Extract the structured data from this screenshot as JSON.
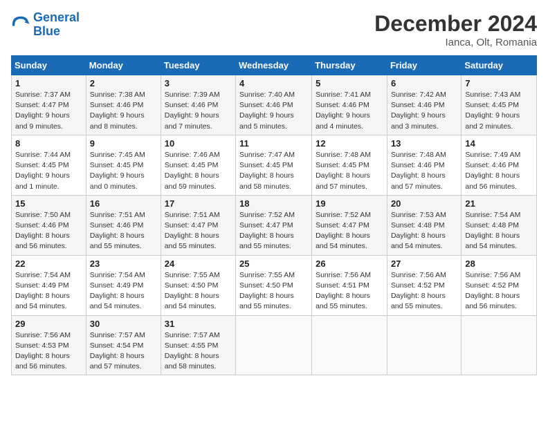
{
  "header": {
    "logo_line1": "General",
    "logo_line2": "Blue",
    "month": "December 2024",
    "location": "Ianca, Olt, Romania"
  },
  "weekdays": [
    "Sunday",
    "Monday",
    "Tuesday",
    "Wednesday",
    "Thursday",
    "Friday",
    "Saturday"
  ],
  "weeks": [
    [
      {
        "day": "1",
        "sunrise": "Sunrise: 7:37 AM",
        "sunset": "Sunset: 4:47 PM",
        "daylight": "Daylight: 9 hours and 9 minutes."
      },
      {
        "day": "2",
        "sunrise": "Sunrise: 7:38 AM",
        "sunset": "Sunset: 4:46 PM",
        "daylight": "Daylight: 9 hours and 8 minutes."
      },
      {
        "day": "3",
        "sunrise": "Sunrise: 7:39 AM",
        "sunset": "Sunset: 4:46 PM",
        "daylight": "Daylight: 9 hours and 7 minutes."
      },
      {
        "day": "4",
        "sunrise": "Sunrise: 7:40 AM",
        "sunset": "Sunset: 4:46 PM",
        "daylight": "Daylight: 9 hours and 5 minutes."
      },
      {
        "day": "5",
        "sunrise": "Sunrise: 7:41 AM",
        "sunset": "Sunset: 4:46 PM",
        "daylight": "Daylight: 9 hours and 4 minutes."
      },
      {
        "day": "6",
        "sunrise": "Sunrise: 7:42 AM",
        "sunset": "Sunset: 4:46 PM",
        "daylight": "Daylight: 9 hours and 3 minutes."
      },
      {
        "day": "7",
        "sunrise": "Sunrise: 7:43 AM",
        "sunset": "Sunset: 4:45 PM",
        "daylight": "Daylight: 9 hours and 2 minutes."
      }
    ],
    [
      {
        "day": "8",
        "sunrise": "Sunrise: 7:44 AM",
        "sunset": "Sunset: 4:45 PM",
        "daylight": "Daylight: 9 hours and 1 minute."
      },
      {
        "day": "9",
        "sunrise": "Sunrise: 7:45 AM",
        "sunset": "Sunset: 4:45 PM",
        "daylight": "Daylight: 9 hours and 0 minutes."
      },
      {
        "day": "10",
        "sunrise": "Sunrise: 7:46 AM",
        "sunset": "Sunset: 4:45 PM",
        "daylight": "Daylight: 8 hours and 59 minutes."
      },
      {
        "day": "11",
        "sunrise": "Sunrise: 7:47 AM",
        "sunset": "Sunset: 4:45 PM",
        "daylight": "Daylight: 8 hours and 58 minutes."
      },
      {
        "day": "12",
        "sunrise": "Sunrise: 7:48 AM",
        "sunset": "Sunset: 4:45 PM",
        "daylight": "Daylight: 8 hours and 57 minutes."
      },
      {
        "day": "13",
        "sunrise": "Sunrise: 7:48 AM",
        "sunset": "Sunset: 4:46 PM",
        "daylight": "Daylight: 8 hours and 57 minutes."
      },
      {
        "day": "14",
        "sunrise": "Sunrise: 7:49 AM",
        "sunset": "Sunset: 4:46 PM",
        "daylight": "Daylight: 8 hours and 56 minutes."
      }
    ],
    [
      {
        "day": "15",
        "sunrise": "Sunrise: 7:50 AM",
        "sunset": "Sunset: 4:46 PM",
        "daylight": "Daylight: 8 hours and 56 minutes."
      },
      {
        "day": "16",
        "sunrise": "Sunrise: 7:51 AM",
        "sunset": "Sunset: 4:46 PM",
        "daylight": "Daylight: 8 hours and 55 minutes."
      },
      {
        "day": "17",
        "sunrise": "Sunrise: 7:51 AM",
        "sunset": "Sunset: 4:47 PM",
        "daylight": "Daylight: 8 hours and 55 minutes."
      },
      {
        "day": "18",
        "sunrise": "Sunrise: 7:52 AM",
        "sunset": "Sunset: 4:47 PM",
        "daylight": "Daylight: 8 hours and 55 minutes."
      },
      {
        "day": "19",
        "sunrise": "Sunrise: 7:52 AM",
        "sunset": "Sunset: 4:47 PM",
        "daylight": "Daylight: 8 hours and 54 minutes."
      },
      {
        "day": "20",
        "sunrise": "Sunrise: 7:53 AM",
        "sunset": "Sunset: 4:48 PM",
        "daylight": "Daylight: 8 hours and 54 minutes."
      },
      {
        "day": "21",
        "sunrise": "Sunrise: 7:54 AM",
        "sunset": "Sunset: 4:48 PM",
        "daylight": "Daylight: 8 hours and 54 minutes."
      }
    ],
    [
      {
        "day": "22",
        "sunrise": "Sunrise: 7:54 AM",
        "sunset": "Sunset: 4:49 PM",
        "daylight": "Daylight: 8 hours and 54 minutes."
      },
      {
        "day": "23",
        "sunrise": "Sunrise: 7:54 AM",
        "sunset": "Sunset: 4:49 PM",
        "daylight": "Daylight: 8 hours and 54 minutes."
      },
      {
        "day": "24",
        "sunrise": "Sunrise: 7:55 AM",
        "sunset": "Sunset: 4:50 PM",
        "daylight": "Daylight: 8 hours and 54 minutes."
      },
      {
        "day": "25",
        "sunrise": "Sunrise: 7:55 AM",
        "sunset": "Sunset: 4:50 PM",
        "daylight": "Daylight: 8 hours and 55 minutes."
      },
      {
        "day": "26",
        "sunrise": "Sunrise: 7:56 AM",
        "sunset": "Sunset: 4:51 PM",
        "daylight": "Daylight: 8 hours and 55 minutes."
      },
      {
        "day": "27",
        "sunrise": "Sunrise: 7:56 AM",
        "sunset": "Sunset: 4:52 PM",
        "daylight": "Daylight: 8 hours and 55 minutes."
      },
      {
        "day": "28",
        "sunrise": "Sunrise: 7:56 AM",
        "sunset": "Sunset: 4:52 PM",
        "daylight": "Daylight: 8 hours and 56 minutes."
      }
    ],
    [
      {
        "day": "29",
        "sunrise": "Sunrise: 7:56 AM",
        "sunset": "Sunset: 4:53 PM",
        "daylight": "Daylight: 8 hours and 56 minutes."
      },
      {
        "day": "30",
        "sunrise": "Sunrise: 7:57 AM",
        "sunset": "Sunset: 4:54 PM",
        "daylight": "Daylight: 8 hours and 57 minutes."
      },
      {
        "day": "31",
        "sunrise": "Sunrise: 7:57 AM",
        "sunset": "Sunset: 4:55 PM",
        "daylight": "Daylight: 8 hours and 58 minutes."
      },
      null,
      null,
      null,
      null
    ]
  ]
}
